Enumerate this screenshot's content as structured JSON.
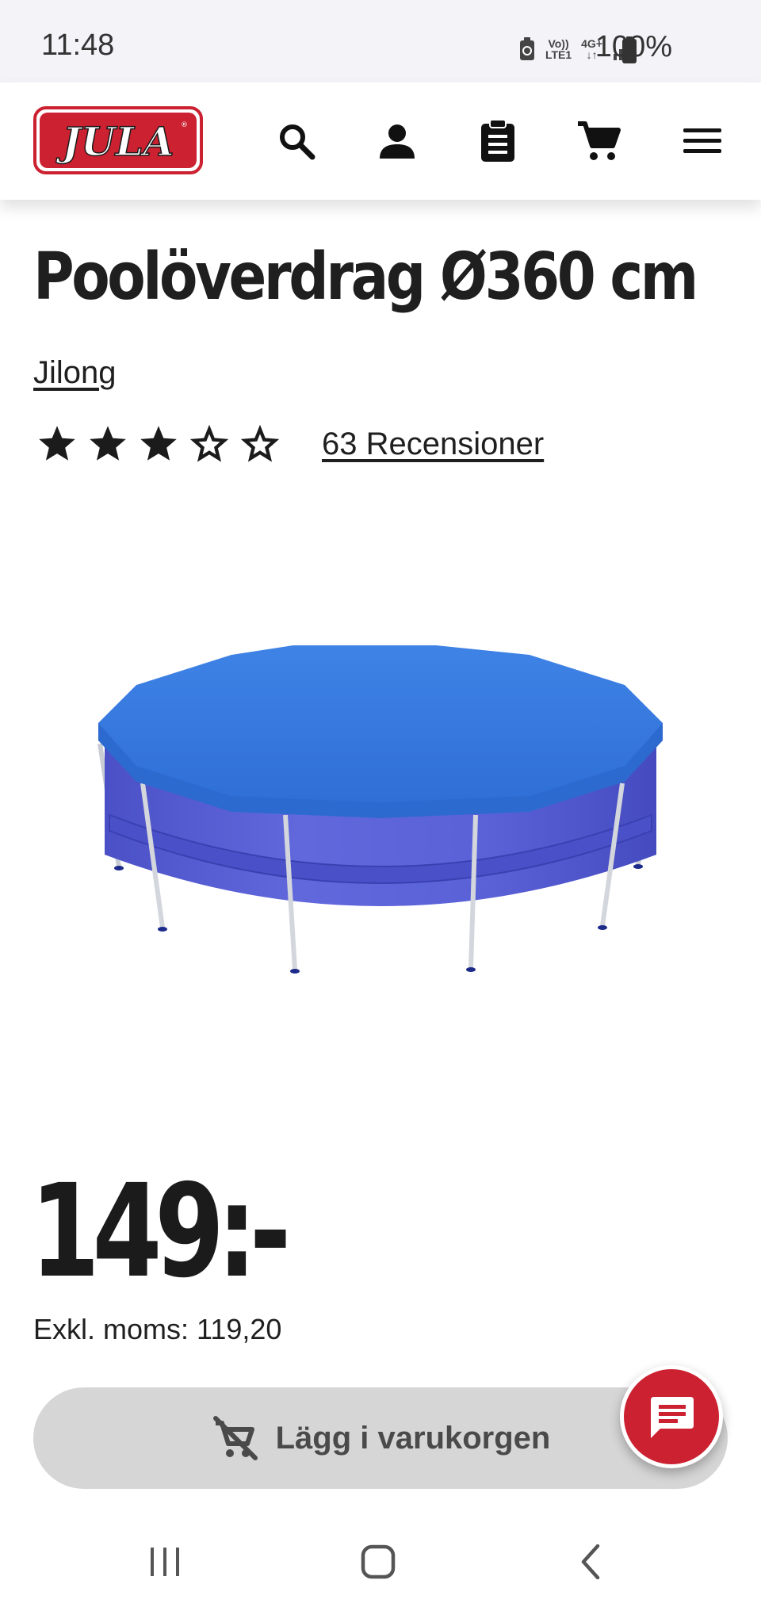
{
  "status_bar": {
    "time": "11:48",
    "network_top": "Vo))",
    "network_bottom": "LTE1",
    "data_type": "4G+",
    "battery": "100%"
  },
  "header": {
    "logo_text": "JULA",
    "icons": [
      "search-icon",
      "user-icon",
      "clipboard-icon",
      "cart-icon",
      "menu-icon"
    ]
  },
  "product": {
    "title": "Poolöverdrag Ø360 cm",
    "brand": "Jilong",
    "rating": 3,
    "rating_max": 5,
    "reviews_label": "63 Recensioner",
    "price": "149:-",
    "vat_label": "Exkl. moms: 119,20",
    "add_to_cart_label": "Lägg i varukorgen"
  },
  "colors": {
    "brand_red": "#cc2131",
    "button_gray": "#d6d6d6",
    "status_bar_bg": "#f3f3f8",
    "pool_cover_blue": "#3b7fe3",
    "pool_body_blue": "#5a63d8"
  }
}
